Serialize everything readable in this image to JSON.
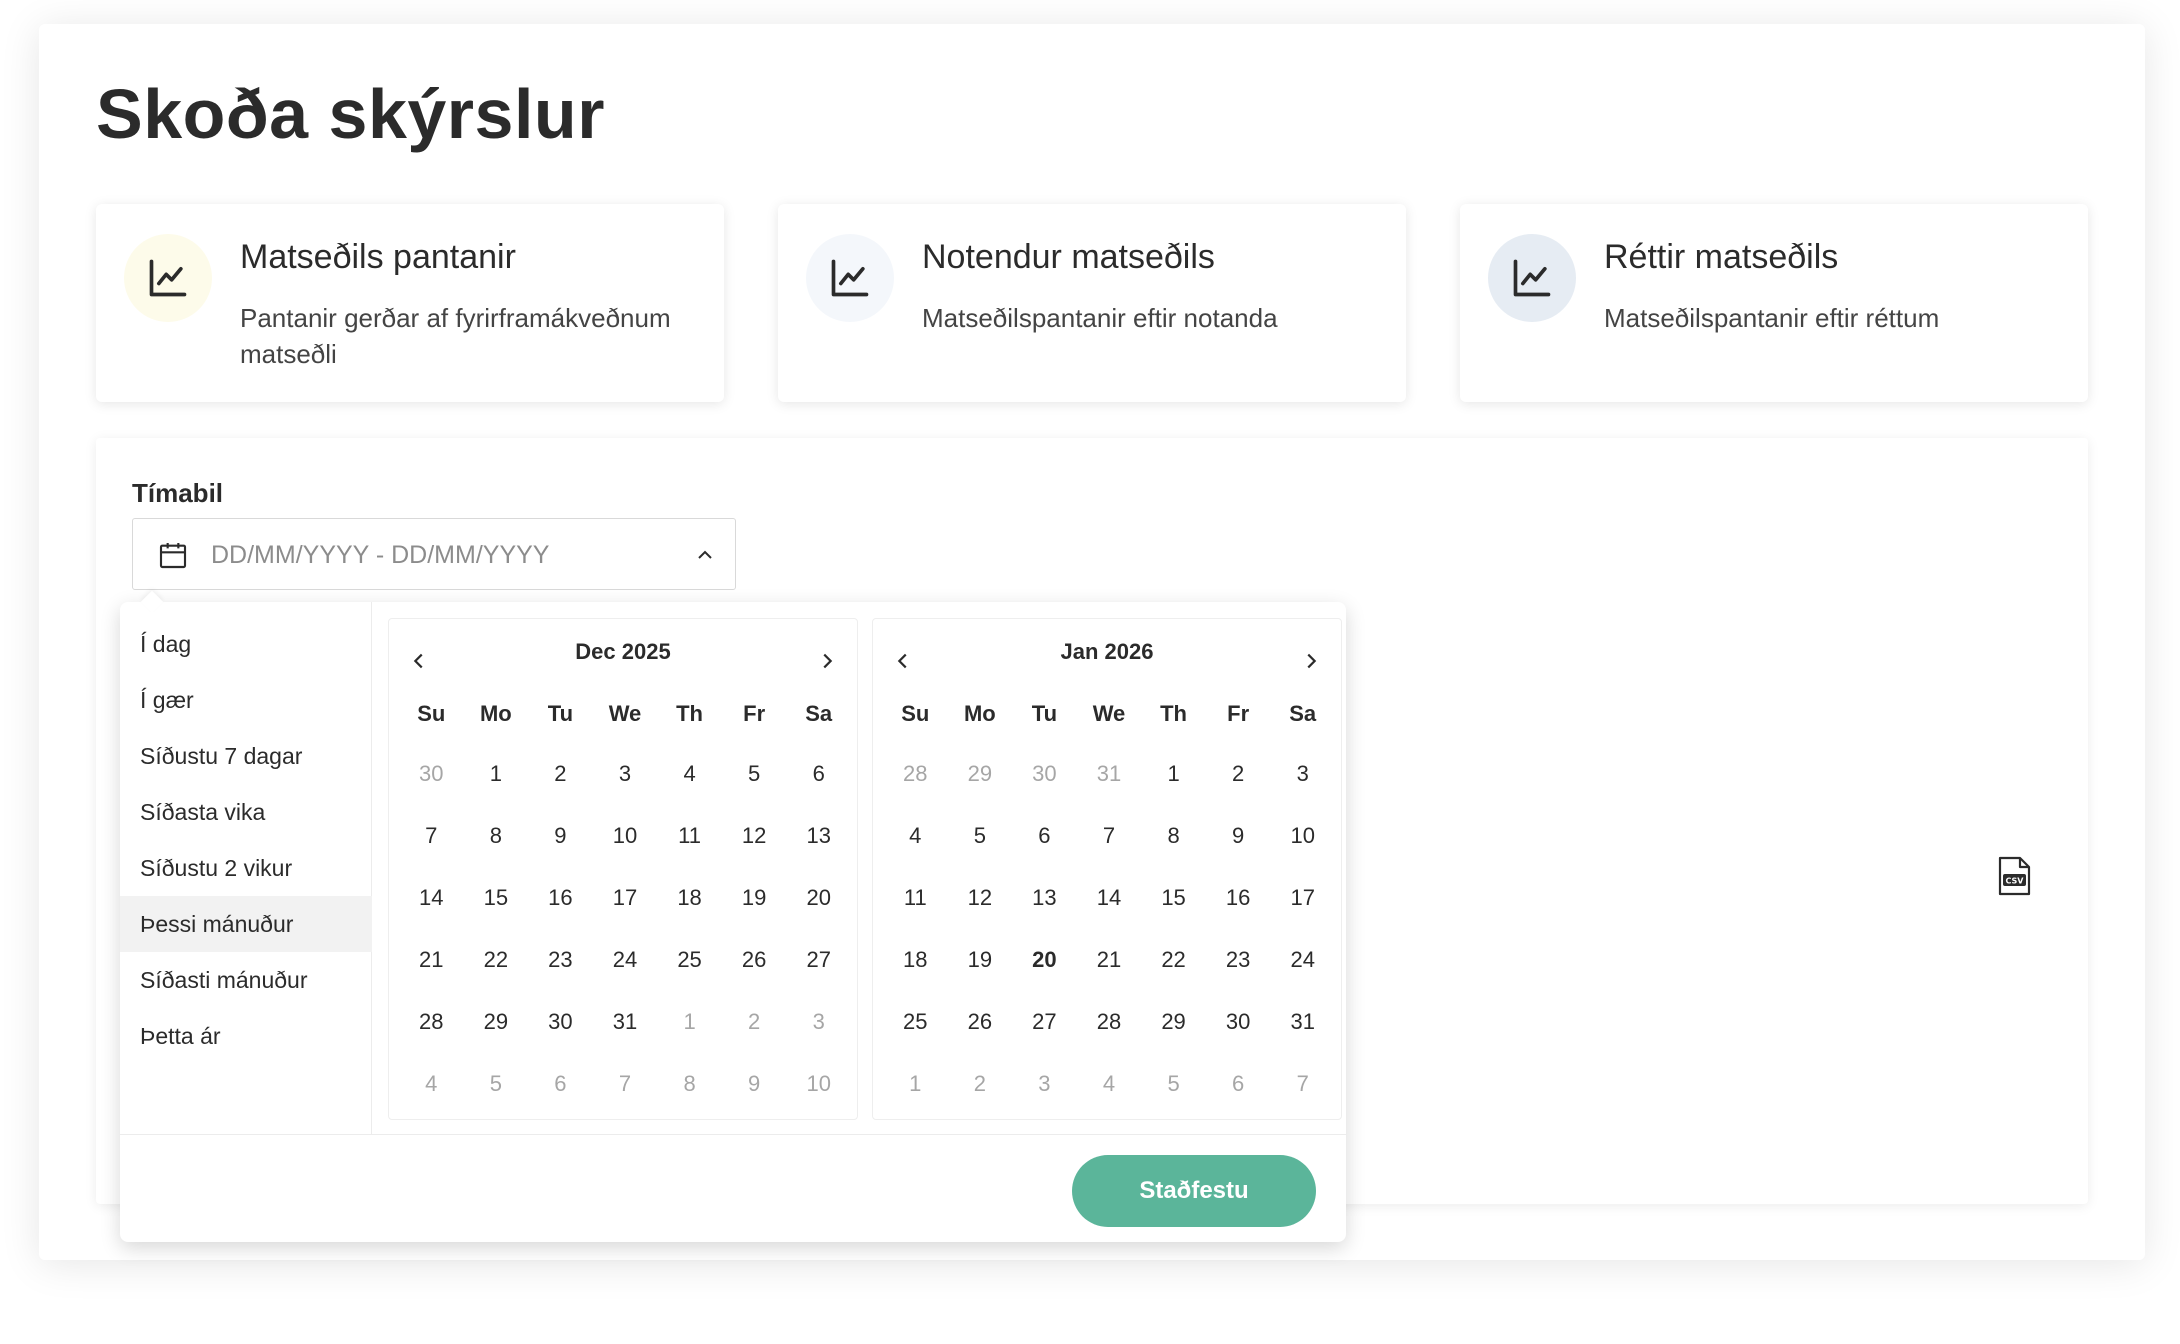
{
  "page": {
    "title": "Skoða skýrslur"
  },
  "report_cards": [
    {
      "title": "Matseðils pantanir",
      "description": "Pantanir gerðar af fyrirframákveðnum matseðli",
      "icon": "chart-line-icon",
      "icon_bg": "#fdfbea"
    },
    {
      "title": "Notendur matseðils",
      "description": "Matseðilspantanir eftir notanda",
      "icon": "chart-line-icon",
      "icon_bg": "#f4f7fb"
    },
    {
      "title": "Réttir matseðils",
      "description": "Matseðilspantanir eftir réttum",
      "icon": "chart-line-icon",
      "icon_bg": "#e6ecf3"
    }
  ],
  "period": {
    "label": "Tímabil",
    "placeholder": "DD/MM/YYYY - DD/MM/YYYY"
  },
  "presets": [
    "Í dag",
    "Í gær",
    "Síðustu 7 dagar",
    "Síðasta vika",
    "Síðustu 2 vikur",
    "Þessi mánuður",
    "Síðasti mánuður",
    "Þetta ár"
  ],
  "active_preset": "Þessi mánuður",
  "weekdays": [
    "Su",
    "Mo",
    "Tu",
    "We",
    "Th",
    "Fr",
    "Sa"
  ],
  "months": [
    {
      "title": "Dec 2025",
      "weeks": [
        [
          [
            "30",
            true
          ],
          [
            "1",
            false
          ],
          [
            "2",
            false
          ],
          [
            "3",
            false
          ],
          [
            "4",
            false
          ],
          [
            "5",
            false
          ],
          [
            "6",
            false
          ]
        ],
        [
          [
            "7",
            false
          ],
          [
            "8",
            false
          ],
          [
            "9",
            false
          ],
          [
            "10",
            false
          ],
          [
            "11",
            false
          ],
          [
            "12",
            false
          ],
          [
            "13",
            false
          ]
        ],
        [
          [
            "14",
            false
          ],
          [
            "15",
            false
          ],
          [
            "16",
            false
          ],
          [
            "17",
            false
          ],
          [
            "18",
            false
          ],
          [
            "19",
            false
          ],
          [
            "20",
            false
          ]
        ],
        [
          [
            "21",
            false
          ],
          [
            "22",
            false
          ],
          [
            "23",
            false
          ],
          [
            "24",
            false
          ],
          [
            "25",
            false
          ],
          [
            "26",
            false
          ],
          [
            "27",
            false
          ]
        ],
        [
          [
            "28",
            false
          ],
          [
            "29",
            false
          ],
          [
            "30",
            false
          ],
          [
            "31",
            false
          ],
          [
            "1",
            true
          ],
          [
            "2",
            true
          ],
          [
            "3",
            true
          ]
        ],
        [
          [
            "4",
            true
          ],
          [
            "5",
            true
          ],
          [
            "6",
            true
          ],
          [
            "7",
            true
          ],
          [
            "8",
            true
          ],
          [
            "9",
            true
          ],
          [
            "10",
            true
          ]
        ]
      ]
    },
    {
      "title": "Jan 2026",
      "weeks": [
        [
          [
            "28",
            true
          ],
          [
            "29",
            true
          ],
          [
            "30",
            true
          ],
          [
            "31",
            true
          ],
          [
            "1",
            false
          ],
          [
            "2",
            false
          ],
          [
            "3",
            false
          ]
        ],
        [
          [
            "4",
            false
          ],
          [
            "5",
            false
          ],
          [
            "6",
            false
          ],
          [
            "7",
            false
          ],
          [
            "8",
            false
          ],
          [
            "9",
            false
          ],
          [
            "10",
            false
          ]
        ],
        [
          [
            "11",
            false
          ],
          [
            "12",
            false
          ],
          [
            "13",
            false
          ],
          [
            "14",
            false
          ],
          [
            "15",
            false
          ],
          [
            "16",
            false
          ],
          [
            "17",
            false
          ]
        ],
        [
          [
            "18",
            false
          ],
          [
            "19",
            false
          ],
          [
            "20",
            false,
            true
          ],
          [
            "21",
            false
          ],
          [
            "22",
            false
          ],
          [
            "23",
            false
          ],
          [
            "24",
            false
          ]
        ],
        [
          [
            "25",
            false
          ],
          [
            "26",
            false
          ],
          [
            "27",
            false
          ],
          [
            "28",
            false
          ],
          [
            "29",
            false
          ],
          [
            "30",
            false
          ],
          [
            "31",
            false
          ]
        ],
        [
          [
            "1",
            true
          ],
          [
            "2",
            true
          ],
          [
            "3",
            true
          ],
          [
            "4",
            true
          ],
          [
            "5",
            true
          ],
          [
            "6",
            true
          ],
          [
            "7",
            true
          ]
        ]
      ]
    }
  ],
  "confirm_label": "Staðfestu",
  "csv_icon_text": "CSV",
  "colors": {
    "accent": "#5bb59a",
    "muted_day": "#a6a6a6",
    "text": "#2b2b2b"
  }
}
